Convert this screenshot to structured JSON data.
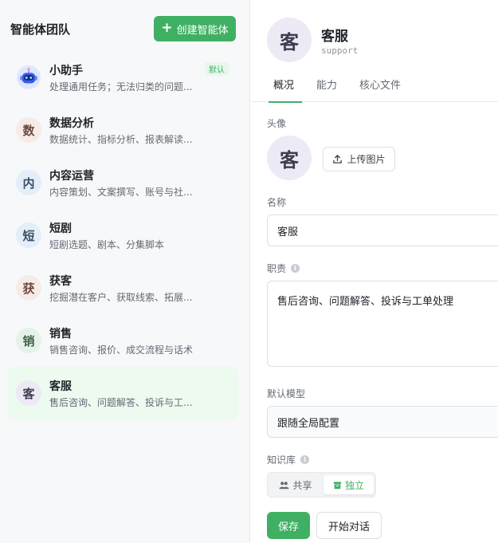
{
  "sidebar": {
    "title": "智能体团队",
    "create_label": "创建智能体",
    "items": [
      {
        "avatar": "",
        "name": "小助手",
        "desc": "处理通用任务；无法归类的问题...",
        "badge": "默认",
        "avatar_bg": "#dfe7ff",
        "avatar_color": "#2c4fd6"
      },
      {
        "avatar": "数",
        "name": "数据分析",
        "desc": "数据统计、指标分析、报表解读...",
        "badge": "",
        "avatar_bg": "#f7ebe7",
        "avatar_color": "#6b4a3f"
      },
      {
        "avatar": "内",
        "name": "内容运营",
        "desc": "内容策划、文案撰写、账号与社...",
        "badge": "",
        "avatar_bg": "#e4eef8",
        "avatar_color": "#3c4f66"
      },
      {
        "avatar": "短",
        "name": "短剧",
        "desc": "短剧选题、剧本、分集脚本",
        "badge": "",
        "avatar_bg": "#e4eef8",
        "avatar_color": "#3c4f66"
      },
      {
        "avatar": "获",
        "name": "获客",
        "desc": "挖掘潜在客户、获取线索、拓展...",
        "badge": "",
        "avatar_bg": "#f7ebe7",
        "avatar_color": "#6b4a3f"
      },
      {
        "avatar": "销",
        "name": "销售",
        "desc": "销售咨询、报价、成交流程与话术",
        "badge": "",
        "avatar_bg": "#e5f2e7",
        "avatar_color": "#3f6149"
      },
      {
        "avatar": "客",
        "name": "客服",
        "desc": "售后咨询、问题解答、投诉与工...",
        "badge": "",
        "avatar_bg": "#ede9f5",
        "avatar_color": "#3d3d4e"
      }
    ]
  },
  "header": {
    "avatar": "客",
    "name": "客服",
    "id": "support"
  },
  "tabs": [
    "概况",
    "能力",
    "核心文件"
  ],
  "form": {
    "avatar_label": "头像",
    "avatar_char": "客",
    "upload_label": "上传图片",
    "name_label": "名称",
    "name_value": "客服",
    "duty_label": "职责",
    "duty_value": "售后咨询、问题解答、投诉与工单处理",
    "model_label": "默认模型",
    "model_value": "跟随全局配置",
    "kb_label": "知识库",
    "kb_shared": "共享",
    "kb_independent": "独立",
    "save_label": "保存",
    "chat_label": "开始对话"
  },
  "colors": {
    "accent": "#3fb063",
    "active_item_bg": "#ecfaf0"
  }
}
